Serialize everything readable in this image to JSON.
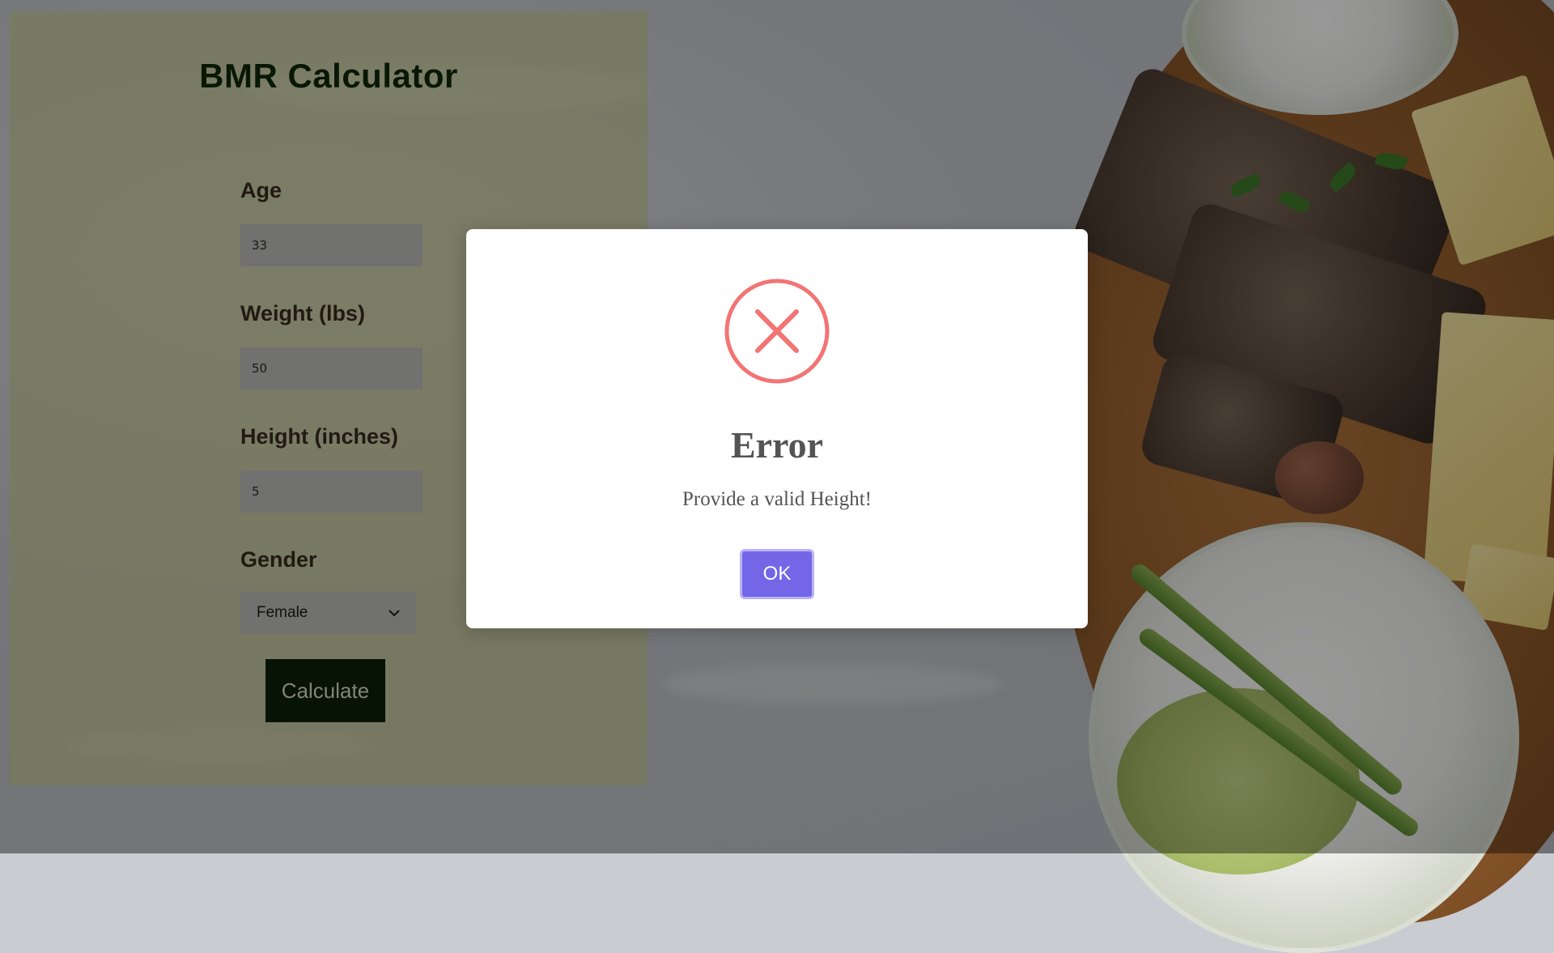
{
  "calculator": {
    "title": "BMR Calculator",
    "fields": {
      "age": {
        "label": "Age",
        "value": "33"
      },
      "weight": {
        "label": "Weight (lbs)",
        "value": "50"
      },
      "height": {
        "label": "Height (inches)",
        "value": "5"
      },
      "gender": {
        "label": "Gender",
        "selected": "Female",
        "icon": "chevron-down-icon"
      }
    },
    "calculate_label": "Calculate"
  },
  "dialog": {
    "title": "Error",
    "message": "Provide a valid Height!",
    "ok_label": "OK",
    "icon": "error-x-icon",
    "colors": {
      "icon": "#f27474",
      "button": "#7367e8",
      "text": "#545454"
    }
  },
  "colors": {
    "panel_title": "#0e2808",
    "calculate_button": "#0d2109"
  }
}
